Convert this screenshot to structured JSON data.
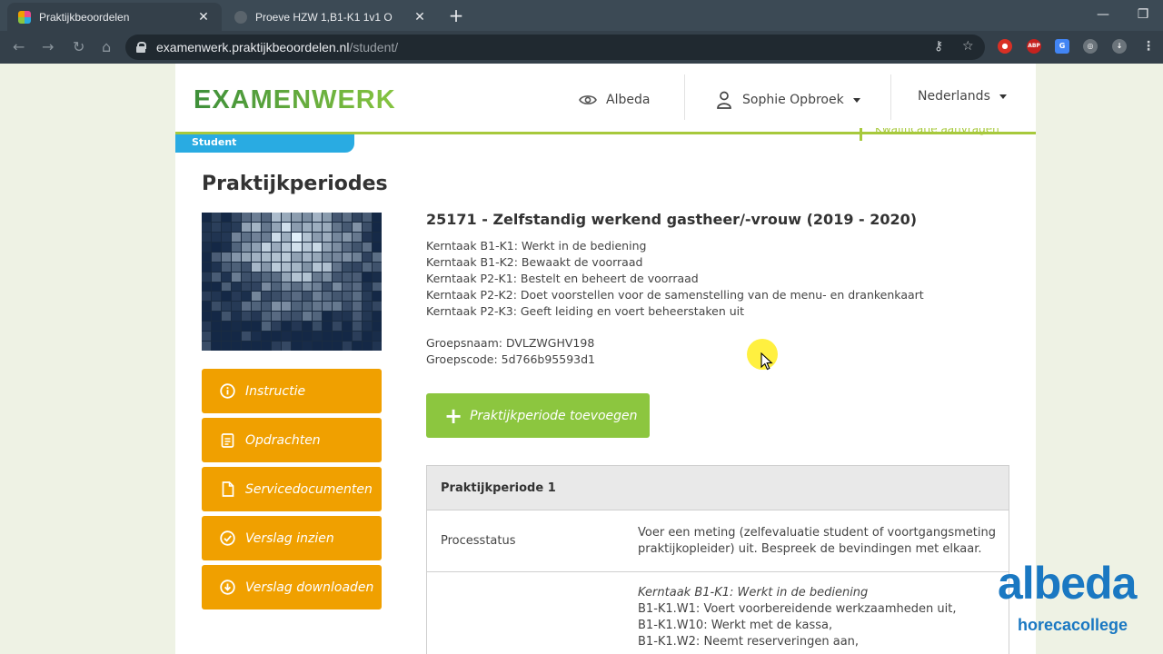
{
  "browser": {
    "tabs": [
      {
        "title": "Praktijkbeoordelen",
        "active": true
      },
      {
        "title": "Proeve HZW 1,B1-K1 1v1 O",
        "active": false
      }
    ],
    "url_host": "examenwerk.praktijkbeoordelen.nl",
    "url_path": "/student/",
    "tab_close_glyph": "✕",
    "new_tab_glyph": "+"
  },
  "header": {
    "logo": "EXAMENWERK",
    "organisation": "Albeda",
    "user": "Sophie Opbroek",
    "language": "Nederlands",
    "role_tab": "Student",
    "qualification_link": "Kwalificatie aanvragen"
  },
  "page": {
    "title": "Praktijkperiodes",
    "course_title": "25171 - Zelfstandig werkend gastheer/-vrouw (2019 - 2020)",
    "kerntaken": [
      "Kerntaak B1-K1: Werkt in de bediening",
      "Kerntaak B1-K2: Bewaakt de voorraad",
      "Kerntaak P2-K1: Bestelt en beheert de voorraad",
      "Kerntaak P2-K2: Doet voorstellen voor de samenstelling van de menu- en drankenkaart",
      "Kerntaak P2-K3: Geeft leiding en voert beheerstaken uit"
    ],
    "groepsnaam": "Groepsnaam: DVLZWGHV198",
    "groepscode": "Groepscode: 5d766b95593d1",
    "add_button": "Praktijkperiode toevoegen"
  },
  "sidebar": {
    "buttons": [
      {
        "label": "Instructie",
        "icon": "info-icon"
      },
      {
        "label": "Opdrachten",
        "icon": "clipboard-icon"
      },
      {
        "label": "Servicedocumenten",
        "icon": "document-icon"
      },
      {
        "label": "Verslag inzien",
        "icon": "check-circle-icon"
      },
      {
        "label": "Verslag downloaden",
        "icon": "download-icon"
      }
    ]
  },
  "period": {
    "heading": "Praktijkperiode 1",
    "status_label": "Processtatus",
    "status_value": "Voer een meting (zelfevaluatie student of voortgangsmeting praktijkopleider) uit. Bespreek de bevindingen met elkaar.",
    "kerntaak_heading": "Kerntaak B1-K1: Werkt in de bediening",
    "werkprocessen": [
      "B1-K1.W1: Voert voorbereidende werkzaamheden uit,",
      "B1-K1.W10: Werkt met de kassa,",
      "B1-K1.W2: Neemt reserveringen aan,"
    ]
  },
  "watermark": {
    "brand": "albeda",
    "sub": "horecacollege"
  },
  "colors": {
    "orange": "#f0a000",
    "green": "#8cc63f",
    "blue": "#29abe2",
    "albeda_blue": "#1a78c2"
  }
}
